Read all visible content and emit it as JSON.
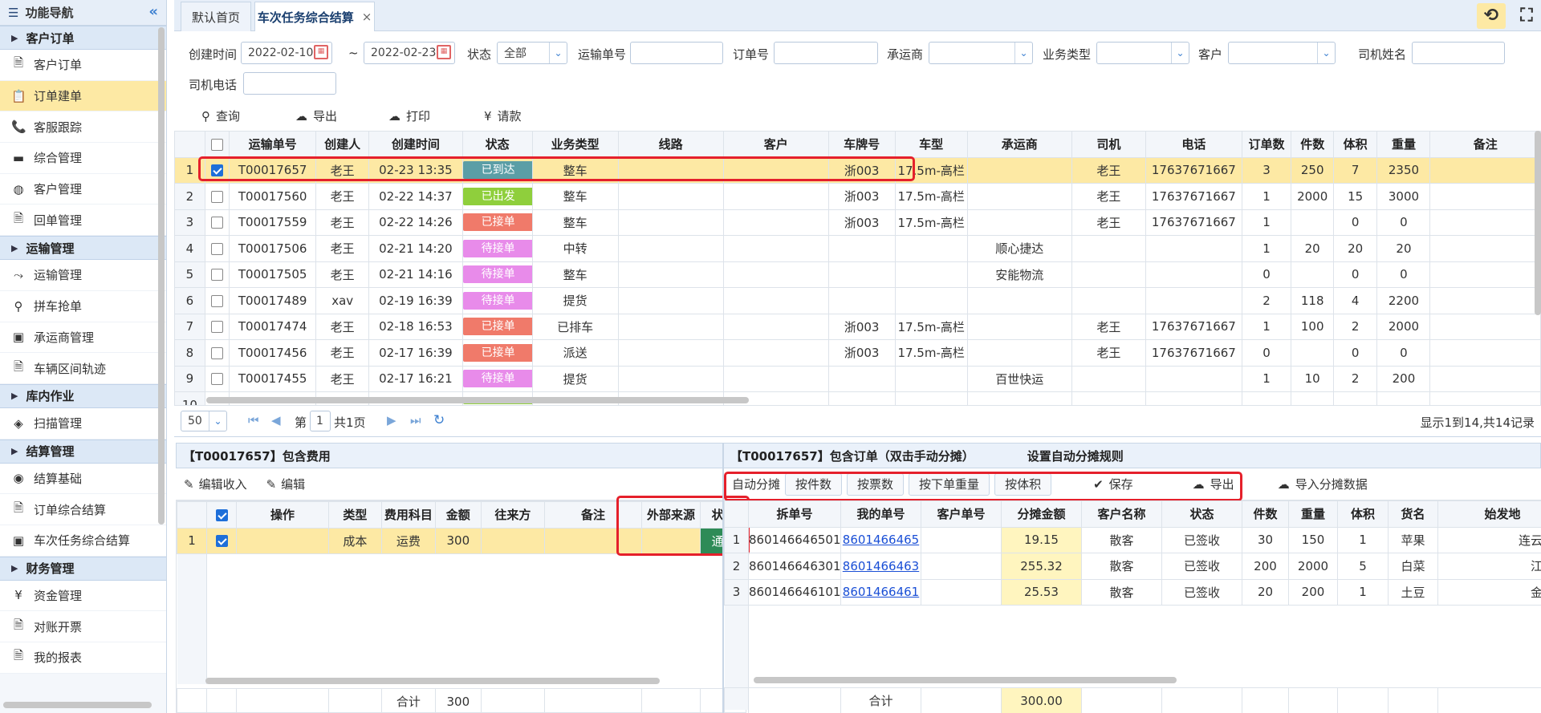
{
  "sidebar": {
    "title": "功能导航",
    "groups": [
      {
        "label": "客户订单",
        "items": [
          {
            "label": "客户订单",
            "icon": "document-icon",
            "glyph": "🗎"
          },
          {
            "label": "订单建单",
            "icon": "clipboard-icon",
            "glyph": "📋",
            "active": true
          },
          {
            "label": "客服跟踪",
            "icon": "phone-icon",
            "glyph": "📞"
          },
          {
            "label": "综合管理",
            "icon": "monitor-icon",
            "glyph": "▬"
          },
          {
            "label": "客户管理",
            "icon": "user-circle-icon",
            "glyph": "◍"
          },
          {
            "label": "回单管理",
            "icon": "document-icon",
            "glyph": "🗎"
          }
        ]
      },
      {
        "label": "运输管理",
        "items": [
          {
            "label": "运输管理",
            "icon": "route-icon",
            "glyph": "⤳"
          },
          {
            "label": "拼车抢单",
            "icon": "map-pin-icon",
            "glyph": "⚲"
          },
          {
            "label": "承运商管理",
            "icon": "bus-icon",
            "glyph": "▣"
          },
          {
            "label": "车辆区间轨迹",
            "icon": "document-icon",
            "glyph": "🗎"
          }
        ]
      },
      {
        "label": "库内作业",
        "items": [
          {
            "label": "扫描管理",
            "icon": "cube-icon",
            "glyph": "◈"
          }
        ]
      },
      {
        "label": "结算管理",
        "items": [
          {
            "label": "结算基础",
            "icon": "eye-icon",
            "glyph": "◉"
          },
          {
            "label": "订单综合结算",
            "icon": "document-icon",
            "glyph": "🗎"
          },
          {
            "label": "车次任务综合结算",
            "icon": "bus-icon",
            "glyph": "▣"
          }
        ]
      },
      {
        "label": "财务管理",
        "items": [
          {
            "label": "资金管理",
            "icon": "yen-icon",
            "glyph": "¥"
          },
          {
            "label": "对账开票",
            "icon": "document-icon",
            "glyph": "🗎"
          },
          {
            "label": "我的报表",
            "icon": "document-icon",
            "glyph": "🗎"
          }
        ]
      }
    ]
  },
  "tabs": [
    {
      "label": "默认首页"
    },
    {
      "label": "车次任务综合结算",
      "close": "×",
      "active": true
    }
  ],
  "filters": {
    "created_label": "创建时间",
    "date_from": "2022-02-10",
    "tilde": "~",
    "date_to": "2022-02-23",
    "status_label": "状态",
    "status_value": "全部",
    "waybill_label": "运输单号",
    "order_label": "订单号",
    "carrier_label": "承运商",
    "biz_label": "业务类型",
    "customer_label": "客户",
    "driver_label": "司机姓名",
    "phone_label": "司机电话"
  },
  "actions": {
    "query": "查询",
    "export": "导出",
    "print": "打印",
    "payment": "请款"
  },
  "main_table": {
    "headers": [
      "运输单号",
      "创建人",
      "创建时间",
      "状态",
      "业务类型",
      "线路",
      "客户",
      "车牌号",
      "车型",
      "承运商",
      "司机",
      "电话",
      "订单数",
      "件数",
      "体积",
      "重量",
      "备注"
    ],
    "rows": [
      {
        "n": "1",
        "checked": true,
        "no": "T00017657",
        "creator": "老王",
        "time": "02-23 13:35",
        "status": "已到达",
        "status_color": "#5b9ea6",
        "biz": "整车",
        "route": "",
        "cust": "",
        "plate": "浙003",
        "vtype": "17.5m-高栏",
        "carrier": "",
        "driver": "老王",
        "phone": "17637671667",
        "orders": "3",
        "pieces": "250",
        "vol": "7",
        "weight": "2350",
        "note": ""
      },
      {
        "n": "2",
        "checked": false,
        "no": "T00017560",
        "creator": "老王",
        "time": "02-22 14:37",
        "status": "已出发",
        "status_color": "#8fcf3c",
        "biz": "整车",
        "route": "",
        "cust": "",
        "plate": "浙003",
        "vtype": "17.5m-高栏",
        "carrier": "",
        "driver": "老王",
        "phone": "17637671667",
        "orders": "1",
        "pieces": "2000",
        "vol": "15",
        "weight": "3000",
        "note": ""
      },
      {
        "n": "3",
        "checked": false,
        "no": "T00017559",
        "creator": "老王",
        "time": "02-22 14:26",
        "status": "已接单",
        "status_color": "#f07a6a",
        "biz": "整车",
        "route": "",
        "cust": "",
        "plate": "浙003",
        "vtype": "17.5m-高栏",
        "carrier": "",
        "driver": "老王",
        "phone": "17637671667",
        "orders": "1",
        "pieces": "",
        "vol": "0",
        "weight": "0",
        "note": ""
      },
      {
        "n": "4",
        "checked": false,
        "no": "T00017506",
        "creator": "老王",
        "time": "02-21 14:20",
        "status": "待接单",
        "status_color": "#e88bea",
        "biz": "中转",
        "route": "",
        "cust": "",
        "plate": "",
        "vtype": "",
        "carrier": "顺心捷达",
        "driver": "",
        "phone": "",
        "orders": "1",
        "pieces": "20",
        "vol": "20",
        "weight": "20",
        "note": ""
      },
      {
        "n": "5",
        "checked": false,
        "no": "T00017505",
        "creator": "老王",
        "time": "02-21 14:16",
        "status": "待接单",
        "status_color": "#e88bea",
        "biz": "整车",
        "route": "",
        "cust": "",
        "plate": "",
        "vtype": "",
        "carrier": "安能物流",
        "driver": "",
        "phone": "",
        "orders": "0",
        "pieces": "",
        "vol": "0",
        "weight": "0",
        "note": ""
      },
      {
        "n": "6",
        "checked": false,
        "no": "T00017489",
        "creator": "xav",
        "time": "02-19 16:39",
        "status": "待接单",
        "status_color": "#e88bea",
        "biz": "提货",
        "route": "",
        "cust": "",
        "plate": "",
        "vtype": "",
        "carrier": "",
        "driver": "",
        "phone": "",
        "orders": "2",
        "pieces": "118",
        "vol": "4",
        "weight": "2200",
        "note": ""
      },
      {
        "n": "7",
        "checked": false,
        "no": "T00017474",
        "creator": "老王",
        "time": "02-18 16:53",
        "status": "已接单",
        "status_color": "#f07a6a",
        "biz": "已排车",
        "route": "",
        "cust": "",
        "plate": "浙003",
        "vtype": "17.5m-高栏",
        "carrier": "",
        "driver": "老王",
        "phone": "17637671667",
        "orders": "1",
        "pieces": "100",
        "vol": "2",
        "weight": "2000",
        "note": ""
      },
      {
        "n": "8",
        "checked": false,
        "no": "T00017456",
        "creator": "老王",
        "time": "02-17 16:39",
        "status": "已接单",
        "status_color": "#f07a6a",
        "biz": "派送",
        "route": "",
        "cust": "",
        "plate": "浙003",
        "vtype": "17.5m-高栏",
        "carrier": "",
        "driver": "老王",
        "phone": "17637671667",
        "orders": "0",
        "pieces": "",
        "vol": "0",
        "weight": "0",
        "note": ""
      },
      {
        "n": "9",
        "checked": false,
        "no": "T00017455",
        "creator": "老王",
        "time": "02-17 16:21",
        "status": "待接单",
        "status_color": "#e88bea",
        "biz": "提货",
        "route": "",
        "cust": "",
        "plate": "",
        "vtype": "",
        "carrier": "百世快运",
        "driver": "",
        "phone": "",
        "orders": "1",
        "pieces": "10",
        "vol": "2",
        "weight": "200",
        "note": ""
      }
    ],
    "partial_row": "10"
  },
  "pager": {
    "size": "50",
    "page_prefix": "第",
    "page": "1",
    "page_suffix": "共1页",
    "summary": "显示1到14,共14记录"
  },
  "fees_panel": {
    "title": "【T00017657】包含费用",
    "edit_income": "编辑收入",
    "edit": "编辑",
    "headers": [
      "操作",
      "类型",
      "费用科目",
      "金额",
      "往来方",
      "备注",
      "外部来源",
      "状态"
    ],
    "rows": [
      {
        "n": "1",
        "checked": true,
        "op": "",
        "type": "成本",
        "subject": "运费",
        "amount": "300",
        "party": "",
        "note": "",
        "source": "",
        "status": "通过"
      }
    ],
    "total_label": "合计",
    "total_value": "300"
  },
  "orders_panel": {
    "title": "【T00017657】包含订单（双击手动分摊）",
    "rule_link": "设置自动分摊规则",
    "auto_label": "自动分摊",
    "auto_buttons": [
      "按件数",
      "按票数",
      "按下单重量",
      "按体积"
    ],
    "save": "保存",
    "export": "导出",
    "import": "导入分摊数据",
    "headers": [
      "拆单号",
      "我的单号",
      "客户单号",
      "分摊金额",
      "客户名称",
      "状态",
      "件数",
      "重量",
      "体积",
      "货名",
      "始发地"
    ],
    "rows": [
      {
        "n": "1",
        "split": "860146646501",
        "mine": "8601466465",
        "cust_no": "",
        "amount": "19.15",
        "cust": "散客",
        "status": "已签收",
        "pieces": "30",
        "weight": "150",
        "vol": "1",
        "goods": "苹果",
        "origin": "连云港市"
      },
      {
        "n": "2",
        "split": "860146646301",
        "mine": "8601466463",
        "cust_no": "",
        "amount": "255.32",
        "cust": "散客",
        "status": "已签收",
        "pieces": "200",
        "weight": "2000",
        "vol": "5",
        "goods": "白菜",
        "origin": "江苏省"
      },
      {
        "n": "3",
        "split": "860146646101",
        "mine": "8601466461",
        "cust_no": "",
        "amount": "25.53",
        "cust": "散客",
        "status": "已签收",
        "pieces": "20",
        "weight": "200",
        "vol": "1",
        "goods": "土豆",
        "origin": "金山区"
      }
    ],
    "total_label": "合计",
    "total_value": "300.00"
  },
  "colors": {
    "accent": "#3b7fd0",
    "selected_row": "#fde9a4",
    "highlight_box": "#e5202b",
    "pass_green": "#2e8b57"
  }
}
